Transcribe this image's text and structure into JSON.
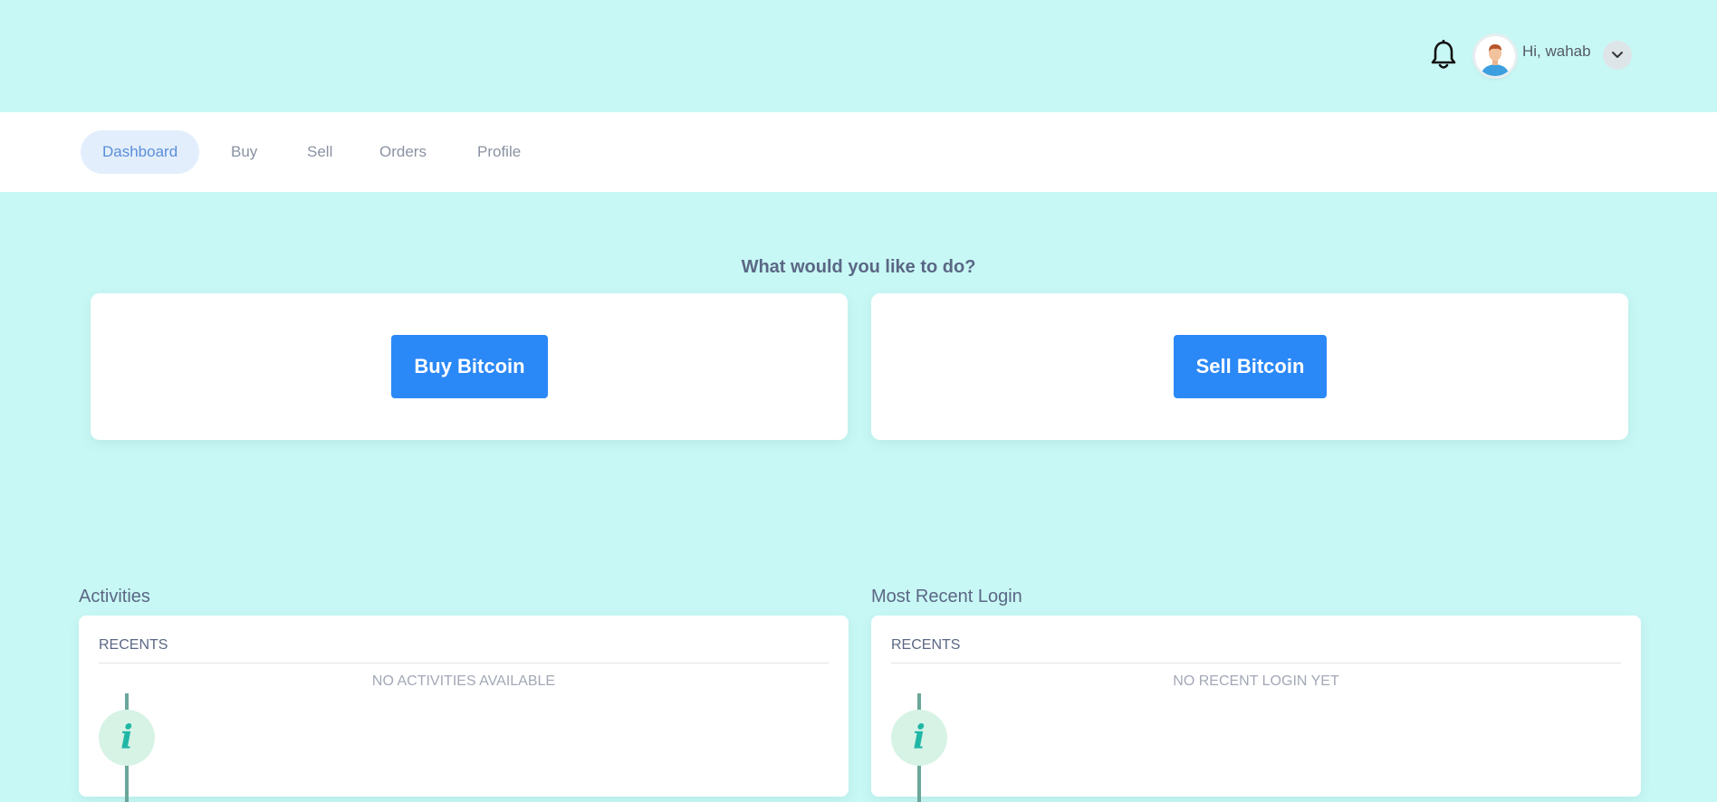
{
  "header": {
    "notification_icon": "bell-icon",
    "avatar_icon": "user-avatar-icon",
    "greeting": "Hi, wahab",
    "dropdown_icon": "chevron-down-icon"
  },
  "nav": {
    "items": [
      {
        "label": "Dashboard",
        "active": true
      },
      {
        "label": "Buy",
        "active": false
      },
      {
        "label": "Sell",
        "active": false
      },
      {
        "label": "Orders",
        "active": false
      },
      {
        "label": "Profile",
        "active": false
      }
    ]
  },
  "main": {
    "question": "What would you like to do?",
    "buy_button": "Buy Bitcoin",
    "sell_button": "Sell Bitcoin"
  },
  "activities": {
    "title": "Activities",
    "subtitle": "RECENTS",
    "empty_text": "NO ACTIVITIES AVAILABLE",
    "icon": "info-icon"
  },
  "recent_login": {
    "title": "Most Recent Login",
    "subtitle": "RECENTS",
    "empty_text": "NO RECENT LOGIN YET",
    "icon": "info-icon"
  },
  "colors": {
    "background": "#c8f8f5",
    "primary_button": "#2b88f7",
    "active_nav_bg": "#e3eefd",
    "active_nav_text": "#5a8fd8",
    "info_accent": "#20b7a6"
  }
}
